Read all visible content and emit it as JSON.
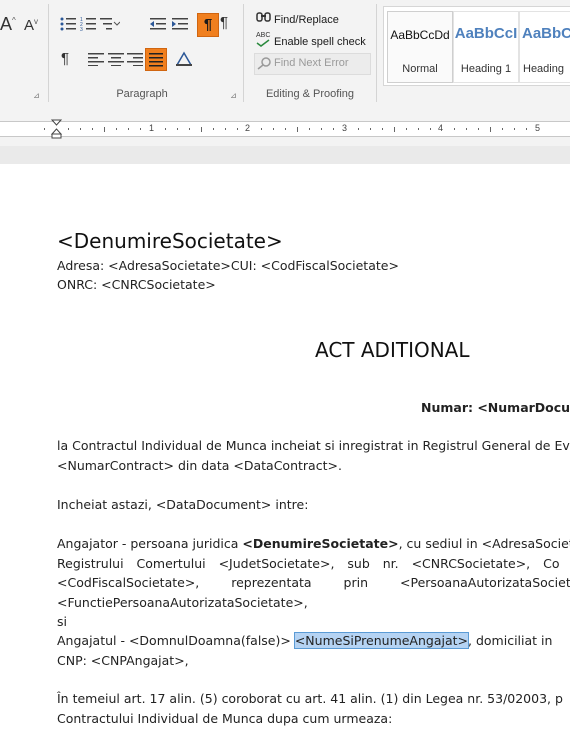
{
  "ribbon": {
    "font_glyphs": [
      "A",
      "A"
    ],
    "paragraph_group_label": "Paragraph",
    "editing_group_label": "Editing & Proofing",
    "find_replace_label": "Find/Replace",
    "spell_check_label": "Enable spell check",
    "spell_check_badge": "ABC",
    "find_next_label": "Find Next Error",
    "pilcrow": "¶",
    "styles": [
      {
        "sample": "AaBbCcDd",
        "name": "Normal"
      },
      {
        "sample": "AaBbCcI",
        "name": "Heading 1"
      },
      {
        "sample": "AaBbCc",
        "name": "Heading"
      }
    ],
    "accent_color": "#f07f1e"
  },
  "ruler": {
    "numbers": [
      "1",
      "2",
      "3",
      "4",
      "5"
    ]
  },
  "document": {
    "company_heading": "<DenumireSocietate>",
    "address_line": "Adresa: <AdresaSocietate>CUI: <CodFiscalSocietate>",
    "onrc_line": "ONRC: <CNRCSocietate>",
    "title": "ACT ADITIONAL",
    "number_line": "Numar: <NumarDocume",
    "p1_line1": "la Contractul Individual de Munca incheiat si inregistrat in Registrul General de Ev",
    "p1_line2": "<NumarContract> din data <DataContract>.",
    "p2": "Incheiat astazi, <DataDocument> intre:",
    "p3_line1_a": "Angajator - persoana juridica ",
    "p3_line1_b": "<DenumireSocietate>",
    "p3_line1_c": ", cu sediul in <AdresaSociet",
    "p3_line2": "Registrului Comertului <JudetSocietate>, sub nr. <CNRCSocietate>, Co",
    "p3_line3": "<CodFiscalSocietate>, reprezentata prin <PersoanaAutorizataSocietate",
    "p3_line4": "<FunctiePersoanaAutorizataSocietate>,",
    "p3_line5": "si",
    "p4_line1_a": "Angajatul - <DomnulDoamna(false)> ",
    "p4_line1_b": "<NumeSiPrenumeAngajat>",
    "p4_line1_c": ", domiciliat in",
    "p4_line2": "CNP: <CNPAngajat>,",
    "p5_line1": "În temeiul art. 17 alin. (5) coroborat cu art. 41 alin. (1) din Legea nr. 53/02003, p",
    "p5_line2": "Contractului Individual de Munca dupa cum urmeaza:"
  }
}
